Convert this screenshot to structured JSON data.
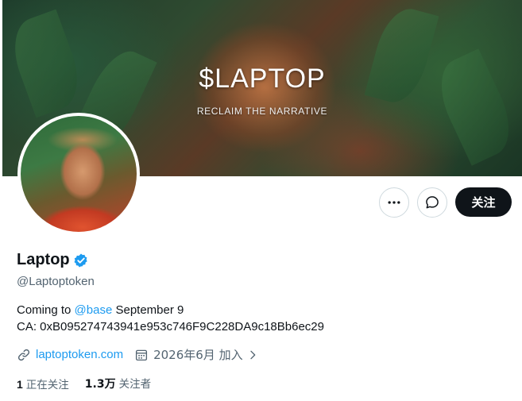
{
  "banner": {
    "title": "$LAPTOP",
    "subtitle": "RECLAIM THE NARRATIVE"
  },
  "profile": {
    "display_name": "Laptop",
    "handle": "@Laptoptoken",
    "verified": true,
    "bio_line1_prefix": "Coming to ",
    "bio_mention": "@base",
    "bio_line1_suffix": " September 9",
    "bio_line2": "CA: 0xB095274743941e953c746F9C228DA9c18Bb6ec29",
    "website": "laptoptoken.com",
    "joined": "2026年6月 加入"
  },
  "actions": {
    "follow_label": "关注"
  },
  "stats": {
    "following_count": "1",
    "following_label": "正在关注",
    "followers_count": "1.3万",
    "followers_label": "关注者"
  },
  "colors": {
    "accent": "#1d9bf0",
    "text": "#0f1419",
    "muted": "#536471",
    "button_dark": "#0f1419"
  },
  "icons": [
    "more-icon",
    "message-icon",
    "verified-badge-icon",
    "link-icon",
    "calendar-icon",
    "chevron-right-icon"
  ]
}
